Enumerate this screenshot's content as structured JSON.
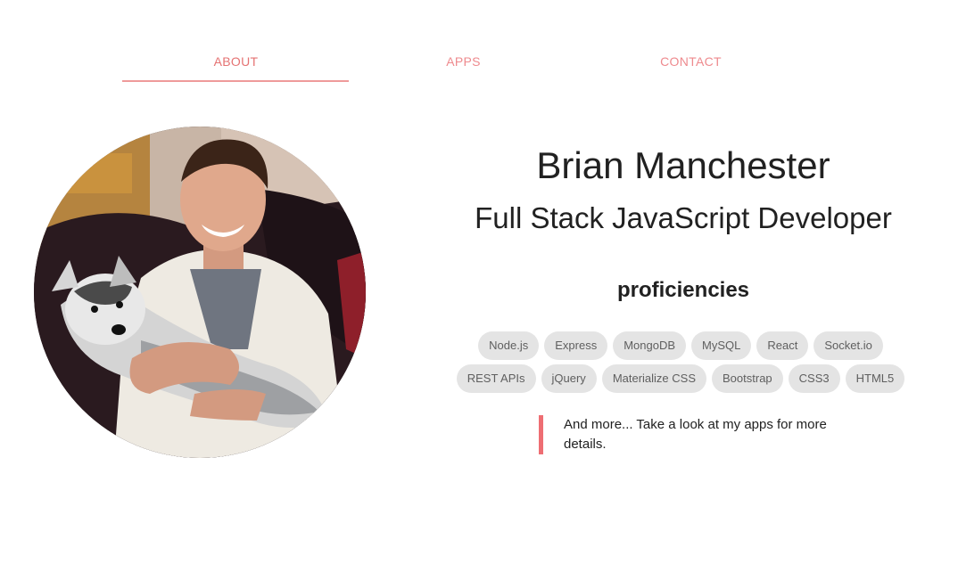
{
  "nav": {
    "tabs": [
      {
        "label": "ABOUT",
        "active": true
      },
      {
        "label": "APPS",
        "active": false
      },
      {
        "label": "CONTACT",
        "active": false
      }
    ]
  },
  "profile": {
    "name": "Brian Manchester",
    "title": "Full Stack JavaScript Developer",
    "photo_alt": "profile photo of man holding a husky puppy"
  },
  "proficiencies": {
    "heading": "proficiencies",
    "skills": [
      "Node.js",
      "Express",
      "MongoDB",
      "MySQL",
      "React",
      "Socket.io",
      "REST APIs",
      "jQuery",
      "Materialize CSS",
      "Bootstrap",
      "CSS3",
      "HTML5"
    ]
  },
  "note": {
    "text": "And more... Take a look at my apps for more details."
  },
  "colors": {
    "accent": "#ee6e73",
    "tab_text": "#ee8a8e",
    "chip_bg": "#e4e4e4"
  }
}
